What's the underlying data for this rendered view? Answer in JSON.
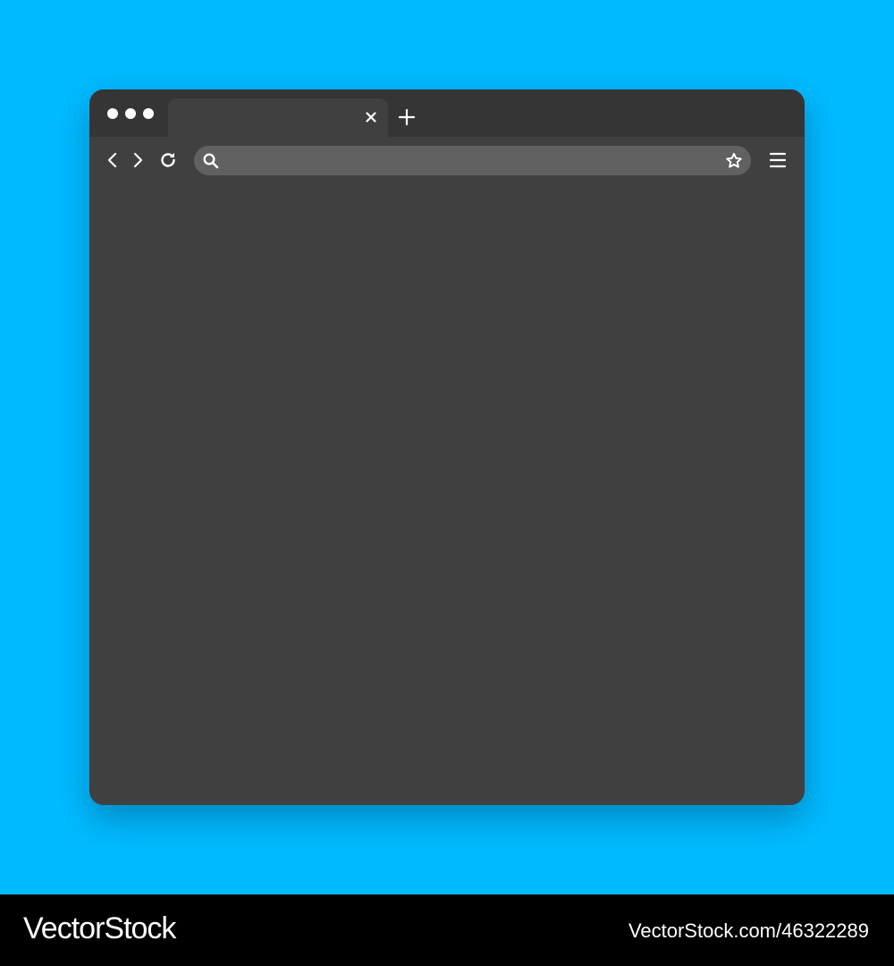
{
  "colors": {
    "background": "#00baff",
    "window": "#404040",
    "titlebar": "#353535",
    "address_bar": "#616161",
    "icon": "#ffffff",
    "footer": "#000000"
  },
  "window": {
    "controls": [
      "dot",
      "dot",
      "dot"
    ],
    "tab": {
      "label": "",
      "close_icon": "close-icon"
    },
    "new_tab_icon": "plus-icon"
  },
  "toolbar": {
    "back_icon": "chevron-left-icon",
    "forward_icon": "chevron-right-icon",
    "reload_icon": "reload-icon",
    "address": {
      "value": "",
      "placeholder": "",
      "search_icon": "search-icon",
      "bookmark_icon": "star-icon"
    },
    "menu_icon": "hamburger-menu-icon"
  },
  "footer": {
    "brand": "VectorStock",
    "url": "VectorStock.com/46322289"
  }
}
